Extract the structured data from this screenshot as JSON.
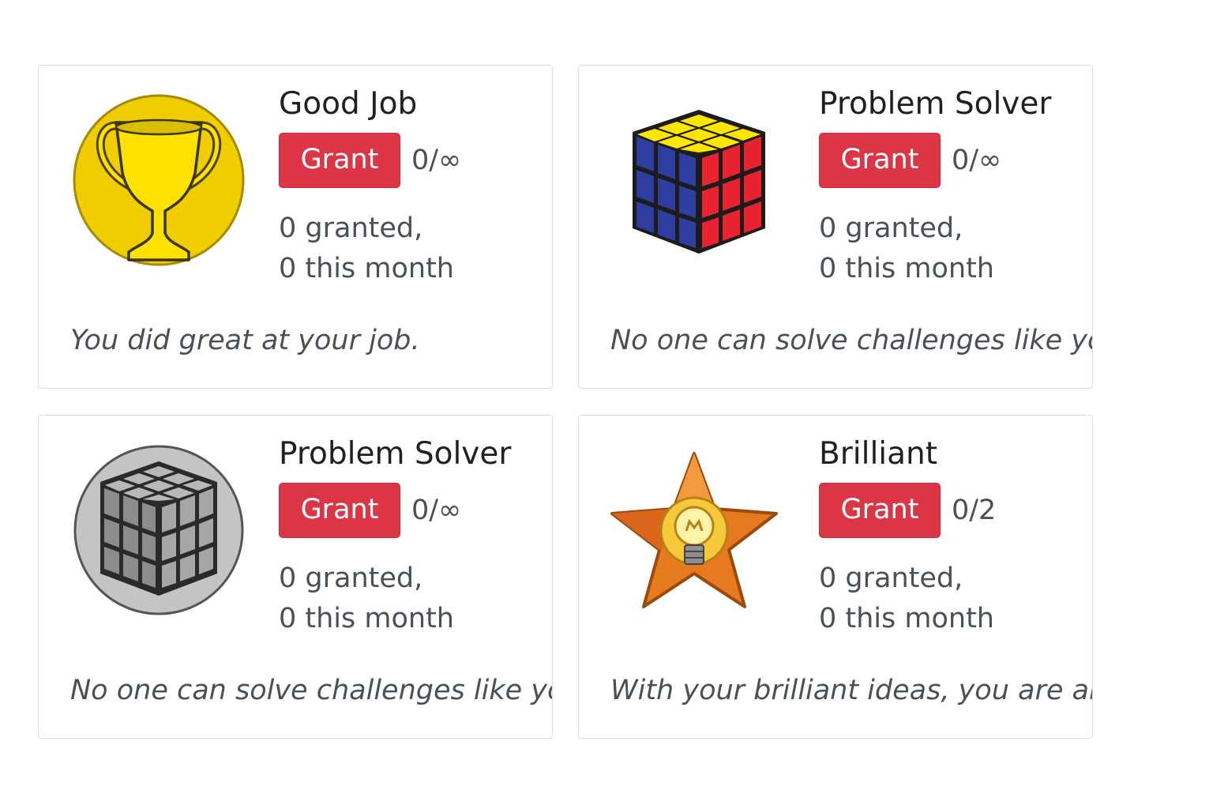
{
  "badges": [
    {
      "icon": "trophy-icon",
      "title": "Good Job",
      "grant_label": "Grant",
      "limit": "0/∞",
      "granted": "0 granted,",
      "this_month": "0 this month",
      "description": "You did great at your job."
    },
    {
      "icon": "rubiks-cube-icon",
      "title": "Problem Solver",
      "grant_label": "Grant",
      "limit": "0/∞",
      "granted": "0 granted,",
      "this_month": "0 this month",
      "description": "No one can solve challenges like you"
    },
    {
      "icon": "gray-cube-icon",
      "title": "Problem Solver",
      "grant_label": "Grant",
      "limit": "0/∞",
      "granted": "0 granted,",
      "this_month": "0 this month",
      "description": "No one can solve challenges like you"
    },
    {
      "icon": "star-lightbulb-icon",
      "title": "Brilliant",
      "grant_label": "Grant",
      "limit": "0/2",
      "granted": "0 granted,",
      "this_month": "0 this month",
      "description": "With your brilliant ideas, you are an"
    }
  ],
  "colors": {
    "grant_button": "#dc3545",
    "card_border": "#dcdfe2",
    "muted_text": "#495057"
  }
}
